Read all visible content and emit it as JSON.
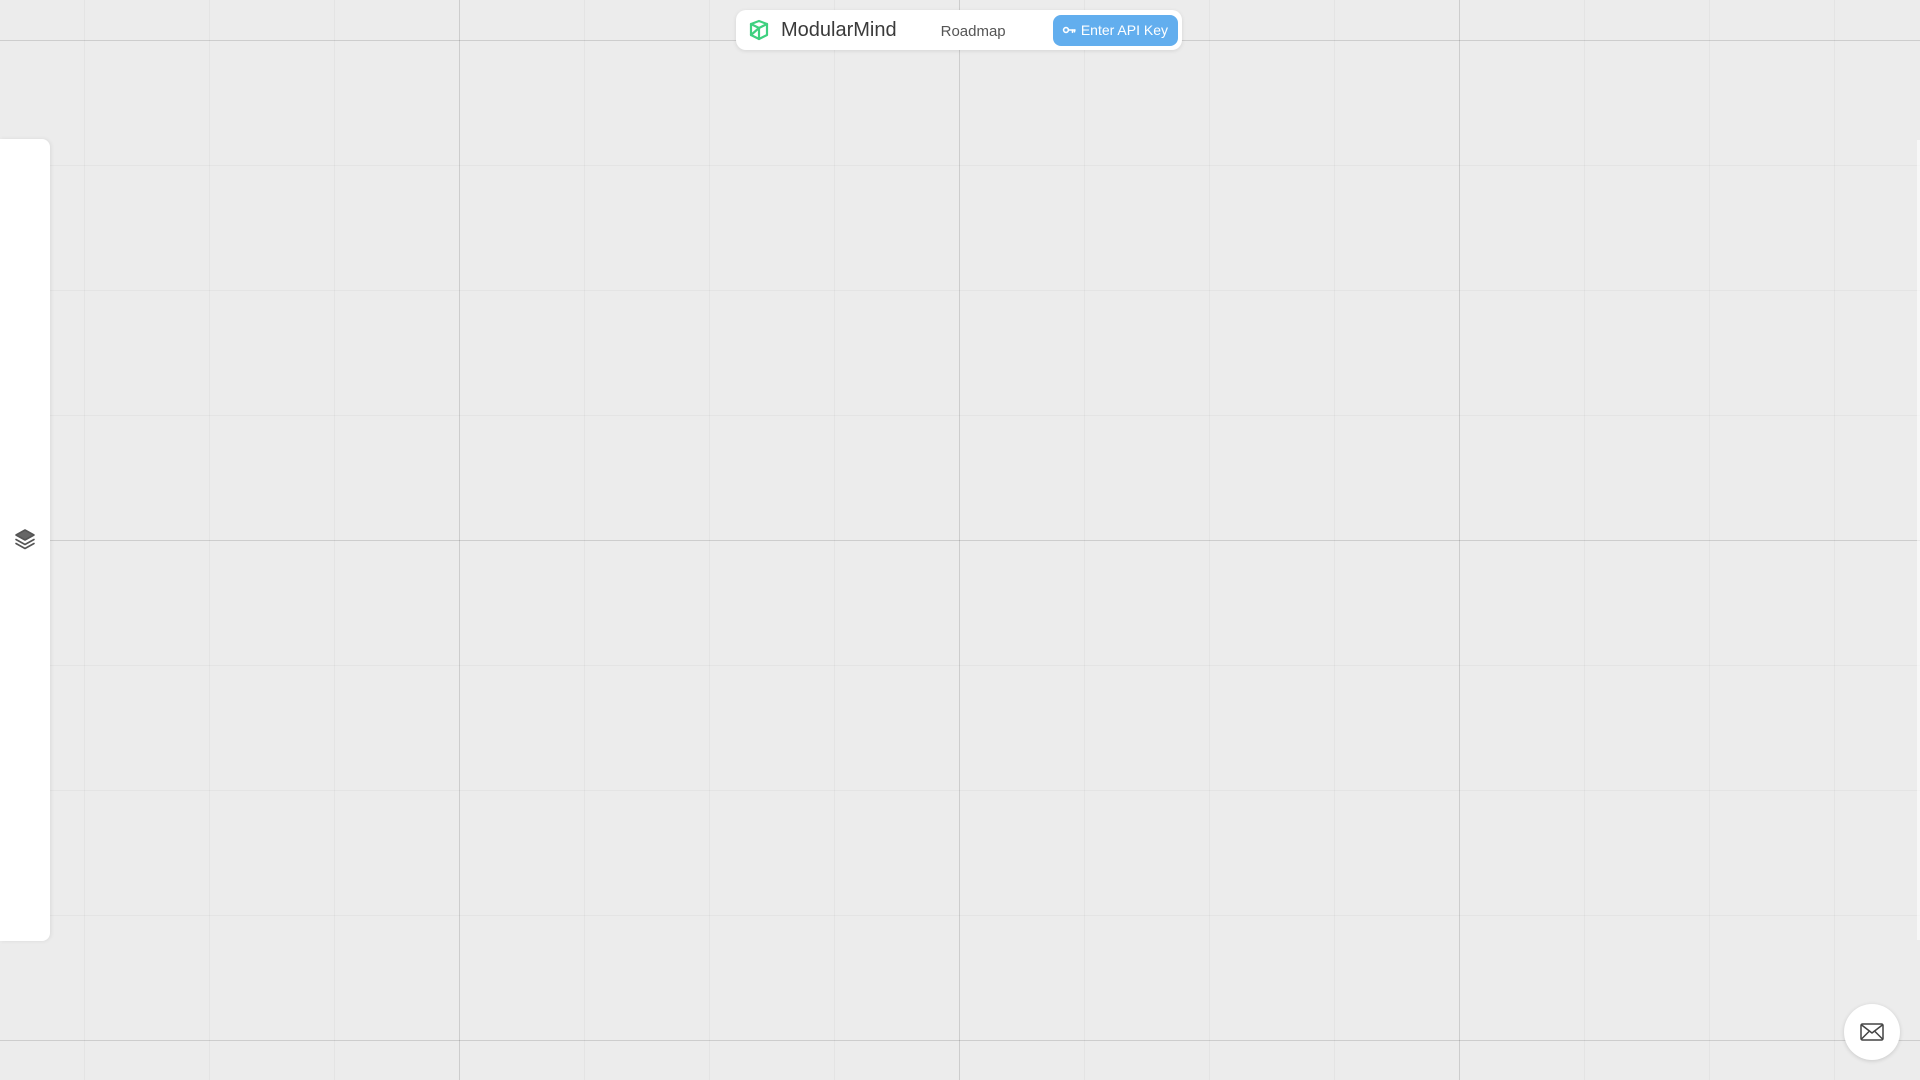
{
  "header": {
    "brand_name": "ModularMind",
    "nav_roadmap": "Roadmap",
    "api_button_label": "Enter API Key",
    "logo_icon": "modularmind-logo-icon",
    "key_icon": "key-icon"
  },
  "sidebar": {
    "icon": "layers-icon"
  },
  "floating": {
    "icon": "mail-icon"
  },
  "colors": {
    "canvas_background": "#ececec",
    "panel_background": "#ffffff",
    "accent_button": "#62aeee",
    "logo_green": "#3ed07f",
    "brand_text": "#3a3a3a"
  }
}
